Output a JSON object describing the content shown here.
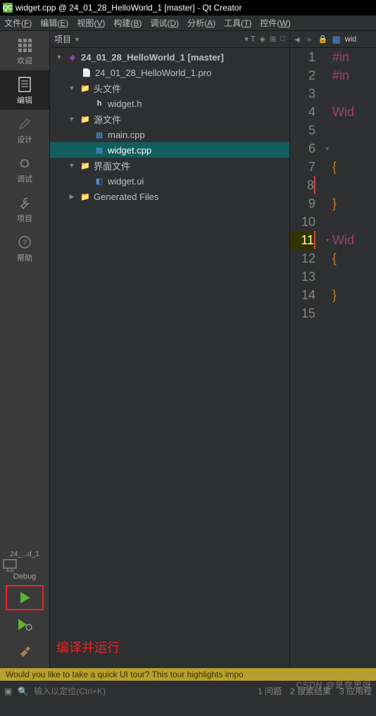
{
  "window": {
    "title": "widget.cpp @ 24_01_28_HelloWorld_1 [master] - Qt Creator"
  },
  "menubar": [
    {
      "label": "文件(F)",
      "key": "F"
    },
    {
      "label": "编辑(E)",
      "key": "E"
    },
    {
      "label": "视图(V)",
      "key": "V"
    },
    {
      "label": "构建(B)",
      "key": "B"
    },
    {
      "label": "调试(D)",
      "key": "D"
    },
    {
      "label": "分析(A)",
      "key": "A"
    },
    {
      "label": "工具(T)",
      "key": "T"
    },
    {
      "label": "控件(W)",
      "key": "W"
    }
  ],
  "leftbar": {
    "modes": [
      {
        "id": "welcome",
        "label": "欢迎"
      },
      {
        "id": "edit",
        "label": "编辑",
        "active": true
      },
      {
        "id": "design",
        "label": "设计"
      },
      {
        "id": "debug",
        "label": "调试"
      },
      {
        "id": "projects",
        "label": "项目"
      },
      {
        "id": "help",
        "label": "帮助"
      }
    ],
    "kit": "24_...d_1",
    "debug_label": "Debug"
  },
  "annotation": "编译并运行",
  "project_pane": {
    "title": "项目",
    "root": "24_01_28_HelloWorld_1 [master]",
    "pro_file": "24_01_28_HelloWorld_1.pro",
    "folders": [
      {
        "name": "头文件",
        "files": [
          "widget.h"
        ]
      },
      {
        "name": "源文件",
        "files": [
          "main.cpp",
          "widget.cpp"
        ],
        "open": true
      },
      {
        "name": "界面文件",
        "files": [
          "widget.ui"
        ]
      },
      {
        "name": "Generated Files",
        "files": []
      }
    ],
    "selected": "widget.cpp"
  },
  "editor": {
    "tab": "wid",
    "current_line": 11,
    "lines": [
      {
        "n": 1,
        "text": "#in",
        "cls": "pp"
      },
      {
        "n": 2,
        "text": "#in",
        "cls": "pp"
      },
      {
        "n": 3,
        "text": "",
        "cls": ""
      },
      {
        "n": 4,
        "text": "Wid",
        "cls": "ty"
      },
      {
        "n": 5,
        "text": "",
        "cls": ""
      },
      {
        "n": 6,
        "text": "",
        "cls": "",
        "fold": true
      },
      {
        "n": 7,
        "text": "{",
        "cls": "kw"
      },
      {
        "n": 8,
        "text": "",
        "cls": "",
        "mark": true
      },
      {
        "n": 9,
        "text": "}",
        "cls": "kw"
      },
      {
        "n": 10,
        "text": "",
        "cls": ""
      },
      {
        "n": 11,
        "text": "Wid",
        "cls": "ty",
        "fold": true,
        "mark": true
      },
      {
        "n": 12,
        "text": "{",
        "cls": "kw"
      },
      {
        "n": 13,
        "text": "",
        "cls": ""
      },
      {
        "n": 14,
        "text": "}",
        "cls": "kw"
      },
      {
        "n": 15,
        "text": "",
        "cls": ""
      }
    ]
  },
  "banner": "Would you like to take a quick UI tour? This tour highlights impo",
  "statusbar": {
    "locator": "输入以定位(Ctrl+K)",
    "items": [
      "1 问题",
      "2 搜索结果",
      "3 应用程"
    ]
  },
  "watermark": "CSDN @是奈思呀"
}
